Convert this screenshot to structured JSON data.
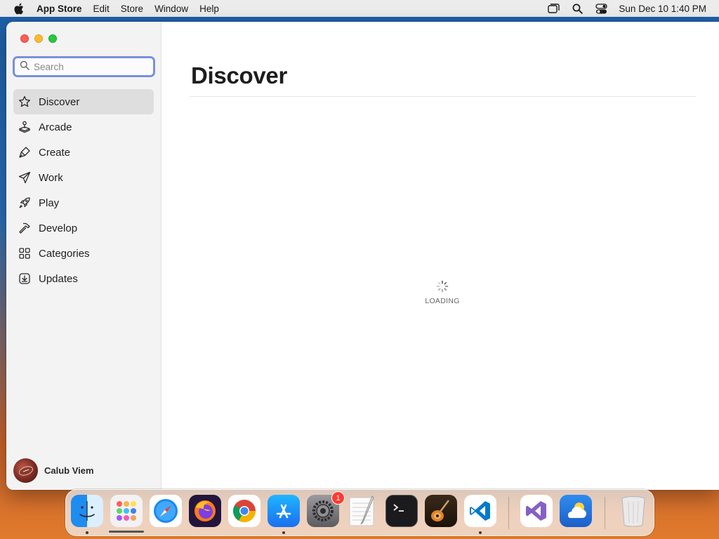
{
  "menubar": {
    "app_name": "App Store",
    "items": [
      "Edit",
      "Store",
      "Window",
      "Help"
    ],
    "clock": "Sun Dec 10  1:40 PM",
    "icons": [
      "window-switcher-icon",
      "spotlight-search-icon",
      "control-center-icon"
    ]
  },
  "window": {
    "search": {
      "placeholder": "Search",
      "value": ""
    },
    "sidebar": {
      "items": [
        {
          "label": "Discover",
          "icon": "star-icon",
          "active": true
        },
        {
          "label": "Arcade",
          "icon": "joystick-icon",
          "active": false
        },
        {
          "label": "Create",
          "icon": "brush-icon",
          "active": false
        },
        {
          "label": "Work",
          "icon": "paper-plane-icon",
          "active": false
        },
        {
          "label": "Play",
          "icon": "rocket-icon",
          "active": false
        },
        {
          "label": "Develop",
          "icon": "hammer-icon",
          "active": false
        },
        {
          "label": "Categories",
          "icon": "grid-icon",
          "active": false
        },
        {
          "label": "Updates",
          "icon": "download-icon",
          "active": false
        }
      ]
    },
    "account": {
      "name": "Calub Viem"
    },
    "main": {
      "title": "Discover",
      "loading_label": "LOADING"
    }
  },
  "dock": {
    "apps": [
      {
        "name": "finder",
        "running": true
      },
      {
        "name": "launchpad",
        "running": false
      },
      {
        "name": "safari",
        "running": false
      },
      {
        "name": "firefox",
        "running": false
      },
      {
        "name": "chrome",
        "running": false
      },
      {
        "name": "app-store",
        "running": true
      },
      {
        "name": "system-settings",
        "running": false,
        "badge": "1"
      },
      {
        "name": "textedit",
        "running": false
      },
      {
        "name": "terminal",
        "running": false
      },
      {
        "name": "garageband",
        "running": false
      },
      {
        "name": "vscode",
        "running": true
      },
      {
        "name": "visual-studio",
        "running": false
      },
      {
        "name": "weather",
        "running": false
      },
      {
        "name": "trash",
        "running": false
      }
    ]
  },
  "colors": {
    "accent_focus": "#7b8fdc",
    "close": "#fe5f57",
    "minimize": "#febc2e",
    "maximize": "#28c840",
    "badge": "#ff3b30"
  }
}
